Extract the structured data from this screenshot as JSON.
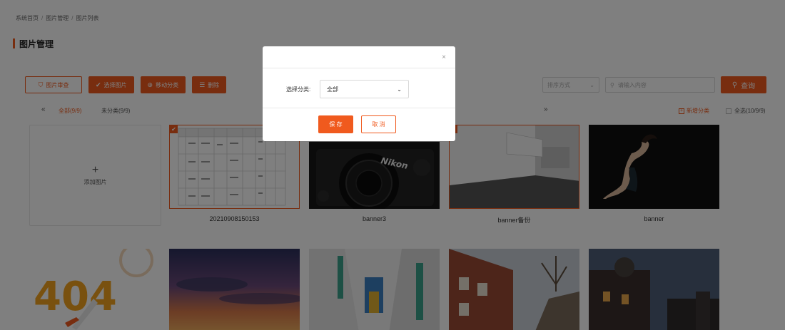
{
  "breadcrumb": [
    "系统首页",
    "图片管理",
    "图片列表"
  ],
  "page_title": "图片管理",
  "toolbar": {
    "image_review": "图片审查",
    "select_image": "选择图片",
    "move_category": "移动分类",
    "delete": "删除"
  },
  "filter": {
    "sort_placeholder": "排序方式",
    "search_placeholder": "请输入内容",
    "query_label": "查询"
  },
  "categories": {
    "prev_icon": "«",
    "all": "全部(9/9)",
    "uncategorized": "未分类(9/9)",
    "next_icon": "»",
    "add_category": "新增分类",
    "select_all": "全选(10/9/9)"
  },
  "add_image_label": "添加图片",
  "images": [
    {
      "caption": "20210908150153",
      "selected": true
    },
    {
      "caption": "banner3",
      "selected": false
    },
    {
      "caption": "banner备份",
      "selected": true
    },
    {
      "caption": "banner",
      "selected": false
    }
  ],
  "modal": {
    "close_icon": "×",
    "field_label": "选择分类:",
    "select_value": "全部",
    "save_label": "保 存",
    "cancel_label": "取 消"
  },
  "colors": {
    "accent": "#f05a1e",
    "overlay": "rgba(0,0,0,0.5)"
  }
}
